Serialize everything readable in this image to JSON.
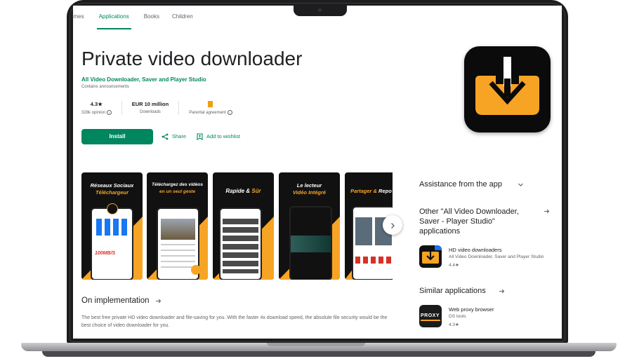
{
  "tabs": [
    {
      "label": "ames"
    },
    {
      "label": "Applications"
    },
    {
      "label": "Books"
    },
    {
      "label": "Children"
    }
  ],
  "app": {
    "title": "Private video downloader",
    "developer": "All Video Downloader, Saver and Player Studio",
    "ads_note": "Contains announcements"
  },
  "stats": {
    "rating_value": "4.3★",
    "rating_label": "328k opinion",
    "downloads_value": "EUR 10 million",
    "downloads_label": "Downloads",
    "parental_label": "Parental agreement"
  },
  "actions": {
    "install": "Install",
    "share": "Share",
    "wishlist": "Add to wishlist"
  },
  "screenshots": [
    {
      "line1": "Réseaux Sociaux",
      "line2": "Téléchargeur",
      "badge": "100MB/S"
    },
    {
      "line1": "Téléchargez des vidéos",
      "line2": "en un seul geste"
    },
    {
      "line1": "Rapide &",
      "line2": "Sûr"
    },
    {
      "line1": "Le lecteur",
      "line2": "Vidéo Intégré"
    },
    {
      "line1": "Partager &",
      "line2": "Repo"
    }
  ],
  "about": {
    "heading": "On implementation",
    "text": "The best free private HD video downloader and file-saving for you. With the faster 4x download speed, the absolute file security would be the best choice of video downloader for you."
  },
  "sidebar": {
    "assistance": "Assistance from the app",
    "other_heading": "Other \"All Video Downloader, Saver - Player Studio\" applications",
    "other_app": {
      "name": "HD video downloaders",
      "dev": "All Video Downloader, Saver and Player Studio",
      "rating": "4.4★"
    },
    "similar_heading": "Similar applications",
    "similar_app": {
      "name": "Web proxy browser",
      "dev": "DS tools",
      "rating": "4.3★",
      "icon_text": "PROXY"
    }
  },
  "colors": {
    "brand_green": "#01875f",
    "accent_orange": "#f7a425"
  }
}
